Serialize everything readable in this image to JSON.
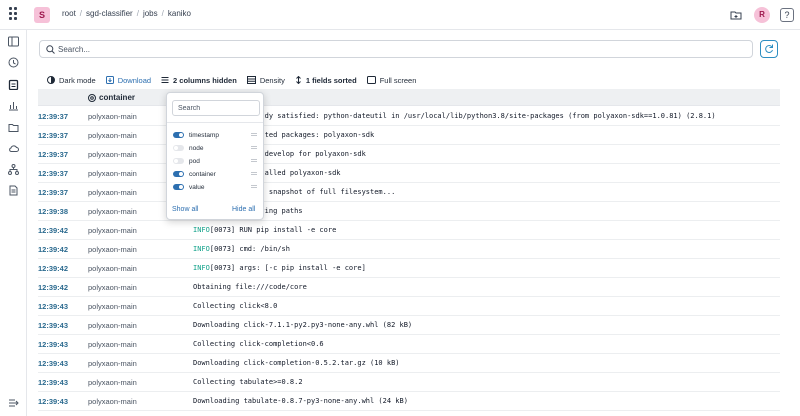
{
  "topbar": {
    "project_initial": "S",
    "breadcrumbs": [
      "root",
      "sgd-classifier",
      "jobs",
      "kaniko"
    ],
    "user_initial": "R",
    "help_label": "?"
  },
  "search": {
    "placeholder": "Search..."
  },
  "toolbar": {
    "dark_mode": "Dark mode",
    "download": "Download",
    "columns_hidden": "2 columns hidden",
    "density": "Density",
    "fields_sorted": "1 fields sorted",
    "full_screen": "Full screen"
  },
  "table": {
    "header_container": "container",
    "rows": [
      {
        "ts": "12:39:37",
        "container": "polyxaon-main",
        "level": "",
        "message": "Requirement already satisfied: python-dateutil in /usr/local/lib/python3.8/site-packages (from polyaxon-sdk==1.0.81) (2.8.1)"
      },
      {
        "ts": "12:39:37",
        "container": "polyxaon-main",
        "level": "",
        "message": "Installing collected packages: polyaxon-sdk"
      },
      {
        "ts": "12:39:37",
        "container": "polyxaon-main",
        "level": "",
        "message": "Running setup.py develop for polyaxon-sdk"
      },
      {
        "ts": "12:39:37",
        "container": "polyxaon-main",
        "level": "",
        "message": "Successfully installed polyaxon-sdk"
      },
      {
        "ts": "12:39:37",
        "container": "polyxaon-main",
        "level": "",
        "message": "INFO[0072] Taking snapshot of full filesystem..."
      },
      {
        "ts": "12:39:38",
        "polyaxon": "",
        "container": "polyxaon-main",
        "level": "",
        "message": "INFO[0073] Resolving paths"
      },
      {
        "ts": "12:39:42",
        "container": "polyxaon-main",
        "level": "INFO",
        "message": "[0073] RUN pip install -e core"
      },
      {
        "ts": "12:39:42",
        "container": "polyxaon-main",
        "level": "INFO",
        "message": "[0073] cmd: /bin/sh"
      },
      {
        "ts": "12:39:42",
        "container": "polyxaon-main",
        "level": "INFO",
        "message": "[0073] args: [-c pip install -e core]"
      },
      {
        "ts": "12:39:42",
        "container": "polyxaon-main",
        "level": "",
        "message": "Obtaining file:///code/core"
      },
      {
        "ts": "12:39:43",
        "container": "polyxaon-main",
        "level": "",
        "message": "Collecting click<8.0"
      },
      {
        "ts": "12:39:43",
        "container": "polyxaon-main",
        "level": "",
        "message": "Downloading click-7.1.1-py2.py3-none-any.whl (82 kB)"
      },
      {
        "ts": "12:39:43",
        "container": "polyxaon-main",
        "level": "",
        "message": "Collecting click-completion<0.6"
      },
      {
        "ts": "12:39:43",
        "container": "polyxaon-main",
        "level": "",
        "message": "Downloading click-completion-0.5.2.tar.gz (10 kB)"
      },
      {
        "ts": "12:39:43",
        "container": "polyxaon-main",
        "level": "",
        "message": "Collecting tabulate>=0.8.2"
      },
      {
        "ts": "12:39:43",
        "container": "polyxaon-main",
        "level": "",
        "message": "Downloading tabulate-0.8.7-py3-none-any.whl (24 kB)"
      }
    ]
  },
  "popover": {
    "search_placeholder": "Search",
    "columns": [
      {
        "label": "timestamp",
        "on": true
      },
      {
        "label": "node",
        "on": false
      },
      {
        "label": "pod",
        "on": false
      },
      {
        "label": "container",
        "on": true
      },
      {
        "label": "value",
        "on": true
      }
    ],
    "show_all": "Show all",
    "hide_all": "Hide all"
  }
}
